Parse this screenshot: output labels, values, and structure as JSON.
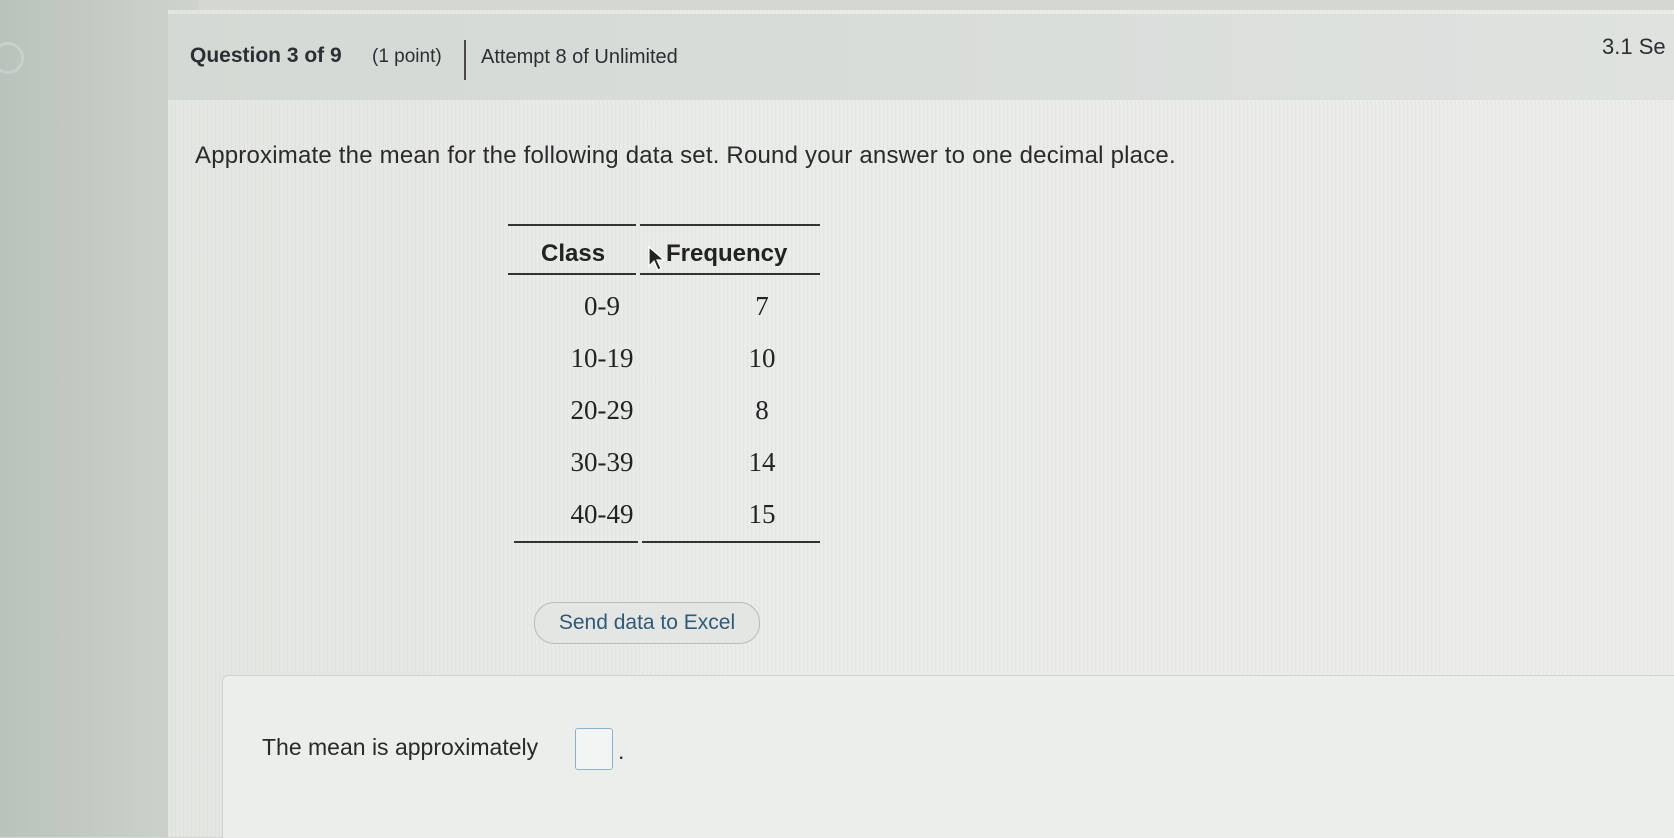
{
  "header": {
    "question": "Question 3 of 9",
    "points": "(1 point)",
    "attempt": "Attempt 8 of Unlimited",
    "section": "3.1 Se"
  },
  "prompt": "Approximate the mean for the following data set. Round your answer to one decimal place.",
  "table": {
    "columns": [
      "Class",
      "Frequency"
    ],
    "rows": [
      {
        "class": "0-9",
        "frequency": "7"
      },
      {
        "class": "10-19",
        "frequency": "10"
      },
      {
        "class": "20-29",
        "frequency": "8"
      },
      {
        "class": "30-39",
        "frequency": "14"
      },
      {
        "class": "40-49",
        "frequency": "15"
      }
    ]
  },
  "excel_button": "Send data to Excel",
  "answer": {
    "label": "The mean is approximately",
    "value": "",
    "suffix": "."
  },
  "icons": {
    "cursor": "mouse-pointer-icon",
    "circle": "circle-icon"
  }
}
